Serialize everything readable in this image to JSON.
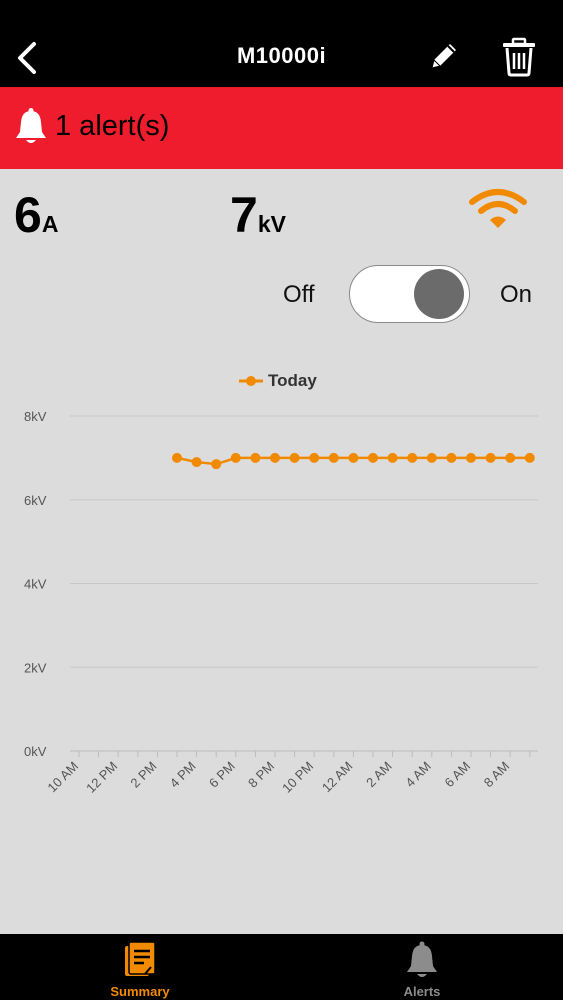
{
  "header": {
    "title": "M10000i",
    "back_icon": "chevron-left-icon",
    "edit_icon": "pencil-icon",
    "delete_icon": "trash-icon"
  },
  "alert_banner": {
    "text": "1 alert(s)",
    "icon": "bell-icon",
    "color": "#ee1c2c"
  },
  "readings": {
    "current": {
      "value": "6",
      "unit": "A"
    },
    "voltage": {
      "value": "7",
      "unit": "kV"
    },
    "signal_icon": "wifi-icon",
    "signal_color": "#f28a00"
  },
  "power_toggle": {
    "off_label": "Off",
    "on_label": "On",
    "state": "on"
  },
  "chart_data": {
    "type": "line",
    "title": "",
    "xlabel": "",
    "ylabel": "",
    "ylim": [
      0,
      8
    ],
    "y_ticks": [
      "0kV",
      "2kV",
      "4kV",
      "6kV",
      "8kV"
    ],
    "x_ticks": [
      "10 AM",
      "12 PM",
      "2 PM",
      "4 PM",
      "6 PM",
      "8 PM",
      "10 PM",
      "12 AM",
      "2 AM",
      "4 AM",
      "6 AM",
      "8 AM"
    ],
    "legend": "top",
    "grid": true,
    "series": [
      {
        "name": "Today",
        "color": "#f28a00",
        "x": [
          "3 PM",
          "4 PM",
          "5 PM",
          "6 PM",
          "7 PM",
          "8 PM",
          "9 PM",
          "10 PM",
          "11 PM",
          "12 AM",
          "1 AM",
          "2 AM",
          "3 AM",
          "4 AM",
          "5 AM",
          "6 AM",
          "7 AM",
          "8 AM",
          "9 AM"
        ],
        "values": [
          7.0,
          6.9,
          6.85,
          7.0,
          7.0,
          7.0,
          7.0,
          7.0,
          7.0,
          7.0,
          7.0,
          7.0,
          7.0,
          7.0,
          7.0,
          7.0,
          7.0,
          7.0,
          7.0
        ]
      }
    ]
  },
  "tabbar": {
    "items": [
      {
        "label": "Summary",
        "icon": "summary-document-icon",
        "active": true
      },
      {
        "label": "Alerts",
        "icon": "bell-icon",
        "active": false
      }
    ],
    "active_color": "#f28a00",
    "inactive_color": "#8c8c8c"
  }
}
